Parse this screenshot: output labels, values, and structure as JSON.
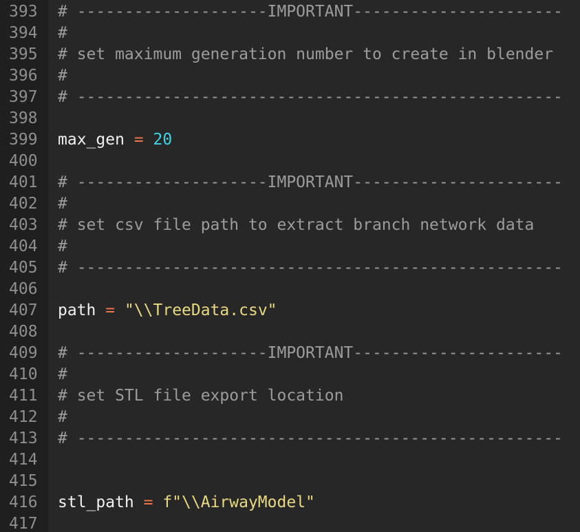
{
  "colors": {
    "background": "#272727",
    "gutter_background": "#1f1f1f",
    "line_number": "#8f8f8f",
    "comment": "#9c9c9c",
    "identifier": "#f0f0f0",
    "operator": "#f2764a",
    "number": "#3fd6ea",
    "string": "#e9d983"
  },
  "lines": [
    {
      "number": "393",
      "segments": [
        {
          "type": "comment",
          "text": "# --------------------IMPORTANT----------------------"
        }
      ]
    },
    {
      "number": "394",
      "segments": [
        {
          "type": "comment",
          "text": "#"
        }
      ]
    },
    {
      "number": "395",
      "segments": [
        {
          "type": "comment",
          "text": "# set maximum generation number to create in blender"
        }
      ]
    },
    {
      "number": "396",
      "segments": [
        {
          "type": "comment",
          "text": "#"
        }
      ]
    },
    {
      "number": "397",
      "segments": [
        {
          "type": "comment",
          "text": "# ---------------------------------------------------"
        }
      ]
    },
    {
      "number": "398",
      "segments": []
    },
    {
      "number": "399",
      "segments": [
        {
          "type": "identifier",
          "text": "max_gen "
        },
        {
          "type": "operator",
          "text": "="
        },
        {
          "type": "number",
          "text": " 20"
        }
      ]
    },
    {
      "number": "400",
      "segments": []
    },
    {
      "number": "401",
      "segments": [
        {
          "type": "comment",
          "text": "# --------------------IMPORTANT----------------------"
        }
      ]
    },
    {
      "number": "402",
      "segments": [
        {
          "type": "comment",
          "text": "#"
        }
      ]
    },
    {
      "number": "403",
      "segments": [
        {
          "type": "comment",
          "text": "# set csv file path to extract branch network data"
        }
      ]
    },
    {
      "number": "404",
      "segments": [
        {
          "type": "comment",
          "text": "#"
        }
      ]
    },
    {
      "number": "405",
      "segments": [
        {
          "type": "comment",
          "text": "# ---------------------------------------------------"
        }
      ]
    },
    {
      "number": "406",
      "segments": []
    },
    {
      "number": "407",
      "segments": [
        {
          "type": "identifier",
          "text": "path "
        },
        {
          "type": "operator",
          "text": "="
        },
        {
          "type": "string",
          "text": " \"\\\\TreeData.csv\""
        }
      ]
    },
    {
      "number": "408",
      "segments": []
    },
    {
      "number": "409",
      "segments": [
        {
          "type": "comment",
          "text": "# --------------------IMPORTANT----------------------"
        }
      ]
    },
    {
      "number": "410",
      "segments": [
        {
          "type": "comment",
          "text": "#"
        }
      ]
    },
    {
      "number": "411",
      "segments": [
        {
          "type": "comment",
          "text": "# set STL file export location"
        }
      ]
    },
    {
      "number": "412",
      "segments": [
        {
          "type": "comment",
          "text": "#"
        }
      ]
    },
    {
      "number": "413",
      "segments": [
        {
          "type": "comment",
          "text": "# ---------------------------------------------------"
        }
      ]
    },
    {
      "number": "414",
      "segments": []
    },
    {
      "number": "415",
      "segments": []
    },
    {
      "number": "416",
      "segments": [
        {
          "type": "identifier",
          "text": "stl_path "
        },
        {
          "type": "operator",
          "text": "="
        },
        {
          "type": "string",
          "text": " f\"\\\\AirwayModel\""
        }
      ]
    },
    {
      "number": "417",
      "segments": []
    }
  ]
}
